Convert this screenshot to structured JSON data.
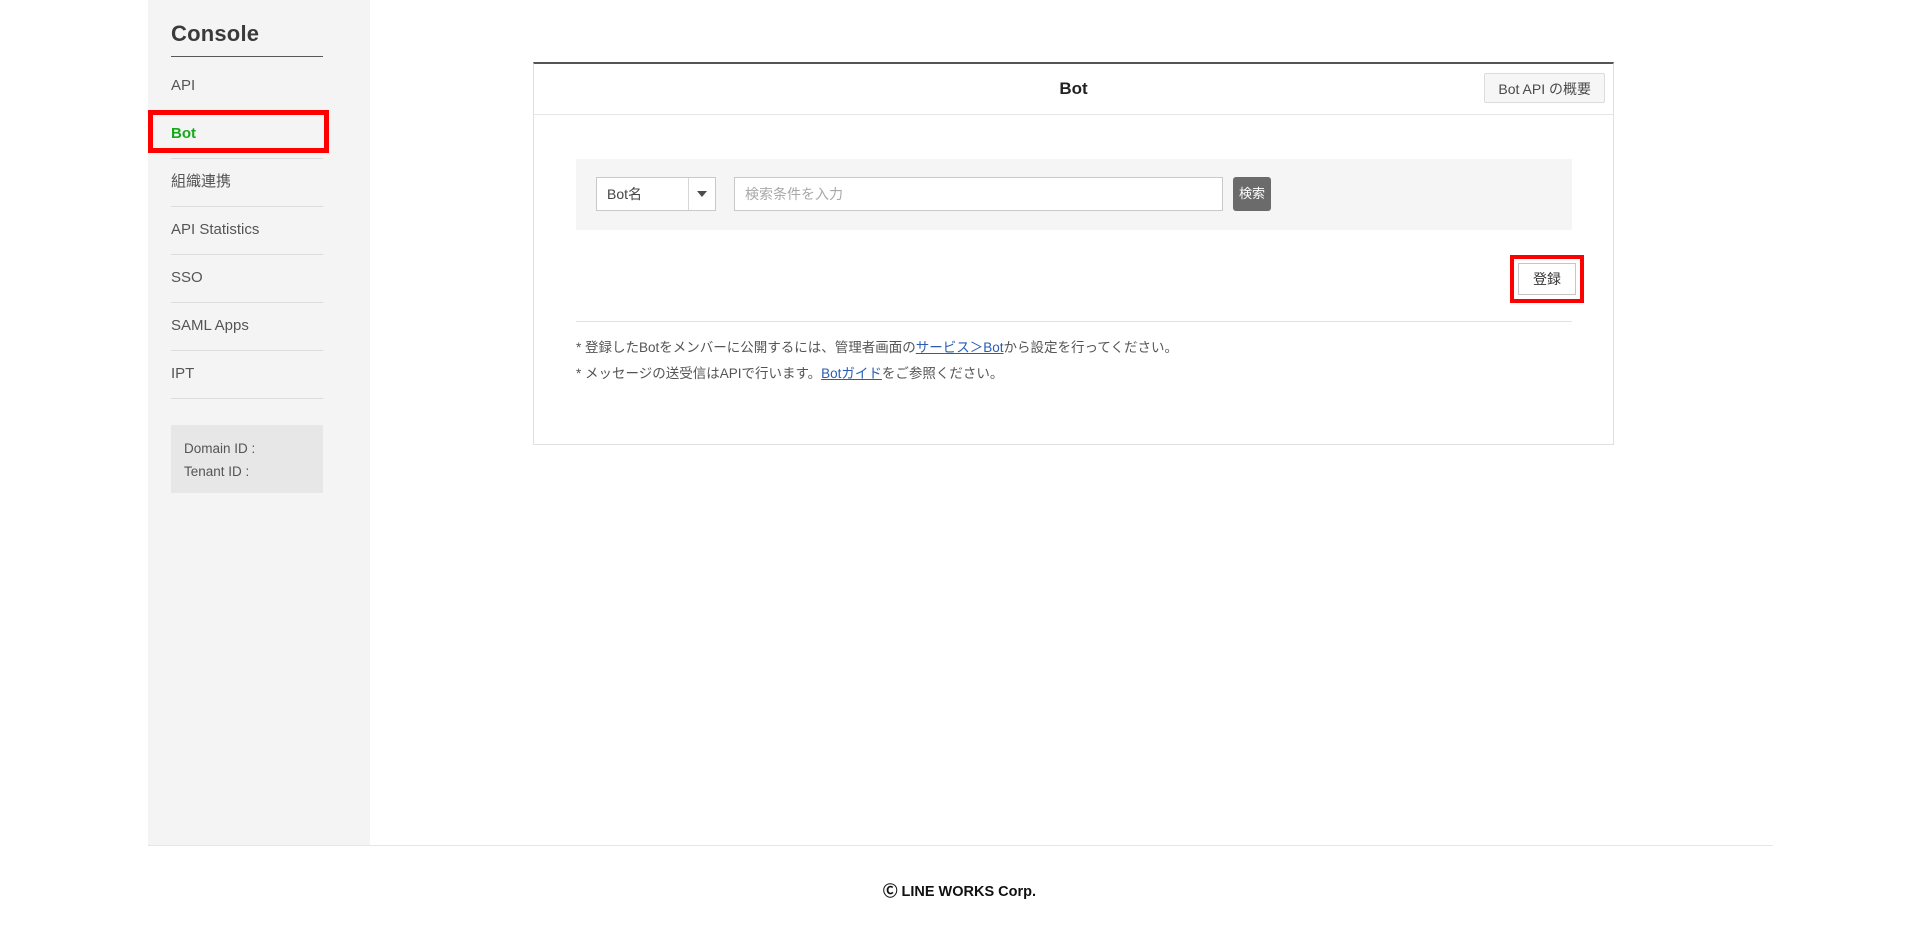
{
  "sidebar": {
    "title": "Console",
    "items": [
      {
        "label": "API",
        "active": false
      },
      {
        "label": "Bot",
        "active": true
      },
      {
        "label": "組織連携",
        "active": false
      },
      {
        "label": "API Statistics",
        "active": false
      },
      {
        "label": "SSO",
        "active": false
      },
      {
        "label": "SAML Apps",
        "active": false
      },
      {
        "label": "IPT",
        "active": false
      }
    ],
    "info": {
      "domain_id": "Domain ID :",
      "tenant_id": "Tenant ID :"
    },
    "highlight_color": "#ff0000",
    "active_color": "#17a81a"
  },
  "panel": {
    "title": "Bot",
    "overview_button": "Bot API の概要",
    "search": {
      "select_value": "Bot名",
      "select_options": [
        "Bot名"
      ],
      "input_value": "",
      "input_placeholder": "検索条件を入力",
      "search_button": "検索"
    },
    "register_button": "登録",
    "notes": [
      {
        "prefix": "* 登録したBotをメンバーに公開するには、管理者画面の",
        "link": "サービス＞Bot",
        "suffix": "から設定を行ってください。"
      },
      {
        "prefix": "* メッセージの送受信はAPIで行います。",
        "link": "Botガイド",
        "suffix": "をご参照ください。"
      }
    ]
  },
  "footer": {
    "copyright": "Ⓒ LINE WORKS Corp."
  }
}
